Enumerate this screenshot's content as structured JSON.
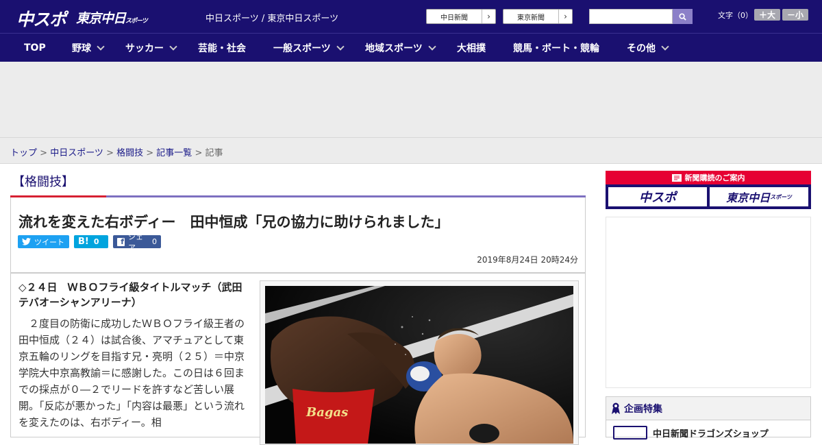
{
  "header": {
    "logo_chunichi": "中スポ",
    "logo_tokyo": "東京中日",
    "logo_tokyo_small": "スポーツ",
    "site_name": "中日スポーツ / 東京中日スポーツ",
    "paper_links": [
      "中日新聞",
      "東京新聞"
    ],
    "search_placeholder": "",
    "font_size_label": "文字（0）",
    "font_plus": "＋大",
    "font_minus": "－小"
  },
  "nav": {
    "items": [
      {
        "label": "TOP"
      },
      {
        "label": "野球"
      },
      {
        "label": "サッカー"
      },
      {
        "label": "芸能・社会"
      },
      {
        "label": "一般スポーツ"
      },
      {
        "label": "地域スポーツ"
      },
      {
        "label": "大相撲"
      },
      {
        "label": "競馬・ボート・競輪"
      },
      {
        "label": "その他"
      }
    ]
  },
  "breadcrumb": {
    "items": [
      "トップ",
      "中日スポーツ",
      "格闘技",
      "記事一覧"
    ],
    "current": "記事",
    "separator": " > "
  },
  "category": "【格闘技】",
  "article": {
    "title": "流れを変えた右ボディー　田中恒成「兄の協力に助けられました」",
    "share": {
      "tweet": "ツイート",
      "hatena_count": "0",
      "fb_label": "シェア",
      "fb_count": "0"
    },
    "date": "2019年8月24日 20時24分",
    "lead": "◇２４日　ＷＢＯフライ級タイトルマッチ（武田テバオーシャンアリーナ）",
    "body": "　２度目の防衛に成功したＷＢＯフライ級王者の田中恒成（２４）は試合後、アマチュアとして東京五輪のリングを目指す兄・亮明（２５）＝中京学院大中京高教諭＝に感謝した。この日は６回までの採点が０―２でリードを許すなど苦しい展開。「反応が悪かった」「内容は最悪」という流れを変えたのは、右ボディー。相"
  },
  "sidebar": {
    "subscribe_head": "新聞購読のご案内",
    "subscribe_logos": [
      "中スポ",
      "東京中日"
    ],
    "subscribe_small": "スポーツ",
    "feature_title": "企画特集",
    "feature_item": "中日新聞ドラゴンズショップ"
  },
  "colors": {
    "brand_navy": "#1a1070",
    "accent_red": "#d62032",
    "accent_purple": "#7d6fc0",
    "twitter": "#1da1f2",
    "hatena": "#00a4de",
    "facebook": "#3b5998"
  }
}
